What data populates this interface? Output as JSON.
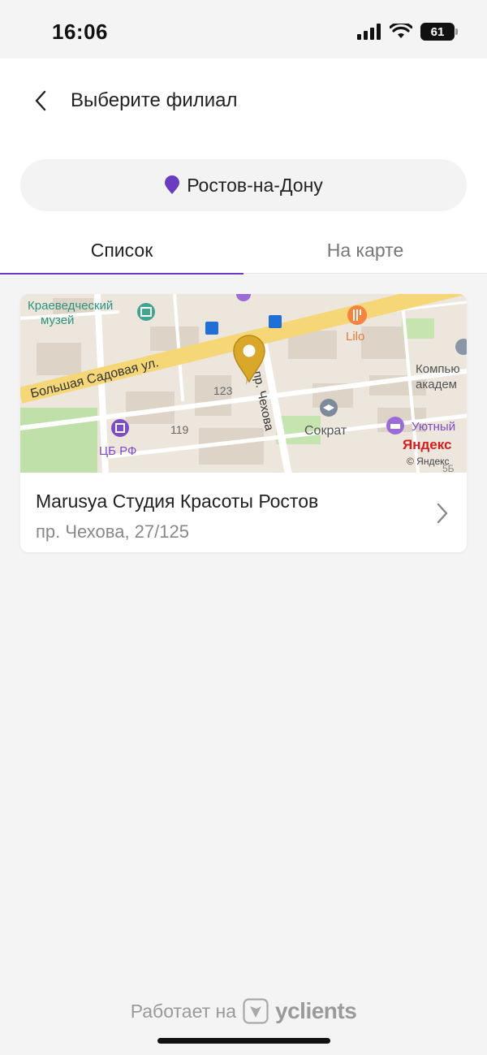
{
  "status_bar": {
    "time": "16:06",
    "battery": "61",
    "icons": [
      "signal-icon",
      "wifi-icon",
      "battery-icon"
    ]
  },
  "header": {
    "title": "Выберите филиал",
    "back_icon": "chevron-left-icon"
  },
  "city": {
    "name": "Ростов-на-Дону",
    "icon": "location-pin-icon",
    "pin_color": "#6a3cbf"
  },
  "tabs": [
    {
      "label": "Список",
      "active": true
    },
    {
      "label": "На карте",
      "active": false
    }
  ],
  "accent_color": "#6a3cbf",
  "branches": [
    {
      "name": "Marusya Студия Красоты Ростов",
      "address": "пр. Чехова, 27/125",
      "map": {
        "labels": {
          "museum": "Краеведческий музей",
          "museum_line1": "Краеведческий",
          "museum_line2": "музей",
          "street_main": "Большая Садовая ул.",
          "street_chekhov": "пр. Чехова",
          "bank": "ЦБ РФ",
          "lilo": "Lilo",
          "company_line1": "Компью",
          "company_line2": "академ",
          "sokrat": "Сократ",
          "hotel": "Уютный",
          "house_123": "123",
          "house_119": "119",
          "house_5b": "5Б",
          "brand": "Яндекс",
          "copyright": "© Яндекс"
        }
      }
    }
  ],
  "footer": {
    "powered_by": "Работает на",
    "brand": "yclients"
  }
}
